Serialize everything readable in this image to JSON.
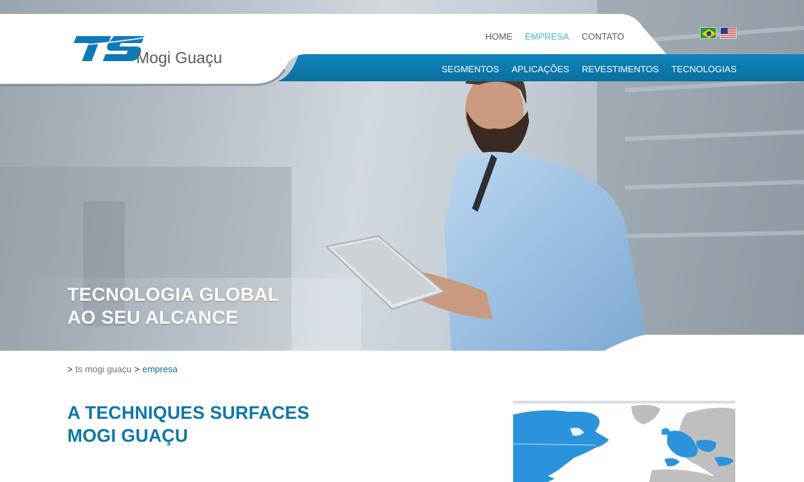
{
  "header": {
    "logo_text": "Mogi Guaçu",
    "top_nav": [
      {
        "label": "HOME",
        "active": false
      },
      {
        "label": "EMPRESA",
        "active": true
      },
      {
        "label": "CONTATO",
        "active": false
      }
    ],
    "main_nav": [
      {
        "label": "SEGMENTOS"
      },
      {
        "label": "APLICAÇÕES"
      },
      {
        "label": "REVESTIMENTOS"
      },
      {
        "label": "TECNOLOGIAS"
      }
    ],
    "languages": [
      "pt-BR-flag",
      "us-flag"
    ]
  },
  "hero": {
    "title_line1": "TECNOLOGIA GLOBAL",
    "title_line2": "AO SEU ALCANCE"
  },
  "breadcrumb": {
    "arrow": ">",
    "parent": "ts mogi guaçu",
    "separator": ">",
    "current": "empresa"
  },
  "content": {
    "title_line1": "A TECHNIQUES SURFACES",
    "title_line2": "MOGI GUAÇU"
  },
  "colors": {
    "brand_blue": "#0c76a8",
    "nav_bar": "#0b7aad",
    "active_link": "#4bb3e2",
    "map_land_highlight": "#2a93dc",
    "map_land_other": "#bfbfbf"
  }
}
